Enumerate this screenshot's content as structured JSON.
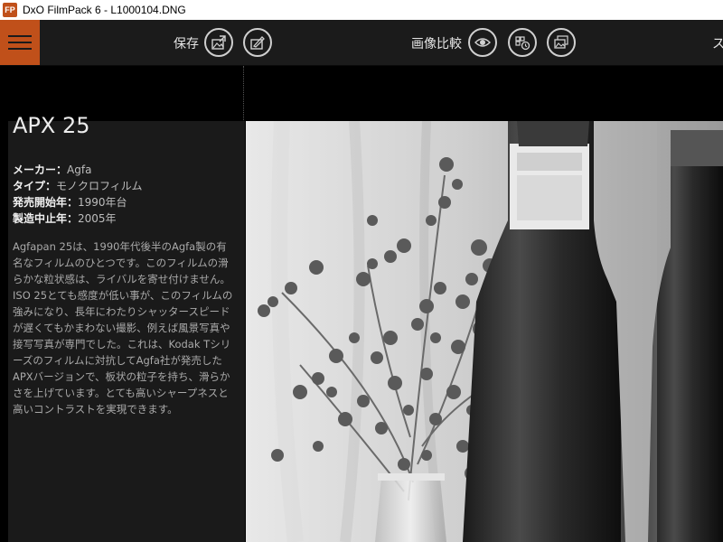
{
  "window": {
    "title": "DxO FilmPack 6 - L1000104.DNG",
    "icon_text": "FP"
  },
  "toolbar": {
    "save_label": "保存",
    "compare_label": "画像比較",
    "cut_label": "ス",
    "accent_color": "#c0501a"
  },
  "film": {
    "name": "APX 25",
    "manufacturer_label": "メーカー：",
    "manufacturer": "Agfa",
    "type_label": "タイプ：",
    "type": "モノクロフィルム",
    "release_label": "発売開始年：",
    "release": "1990年台",
    "discontinued_label": "製造中止年：",
    "discontinued": "2005年",
    "description": "Agfapan 25は、1990年代後半のAgfa製の有名なフィルムのひとつです。このフィルムの滑らかな粒状感は、ライバルを寄せ付けません。ISO 25とても感度が低い事が、このフィルムの強みになり、長年にわたりシャッタースピードが遅くてもかまわない撮影、例えば風景写真や接写写真が専門でした。これは、Kodak Tシリーズのフィルムに対抗してAgfa社が発売したAPXバージョンで、板状の粒子を持ち、滑らかさを上げています。とても高いシャープネスと高いコントラストを実現できます。"
  },
  "icons": {
    "menu": "hamburger-icon",
    "export": "export-image-icon",
    "edit_export": "edit-export-icon",
    "eye": "eye-icon",
    "presets": "preset-clock-icon",
    "images": "image-stack-icon"
  }
}
